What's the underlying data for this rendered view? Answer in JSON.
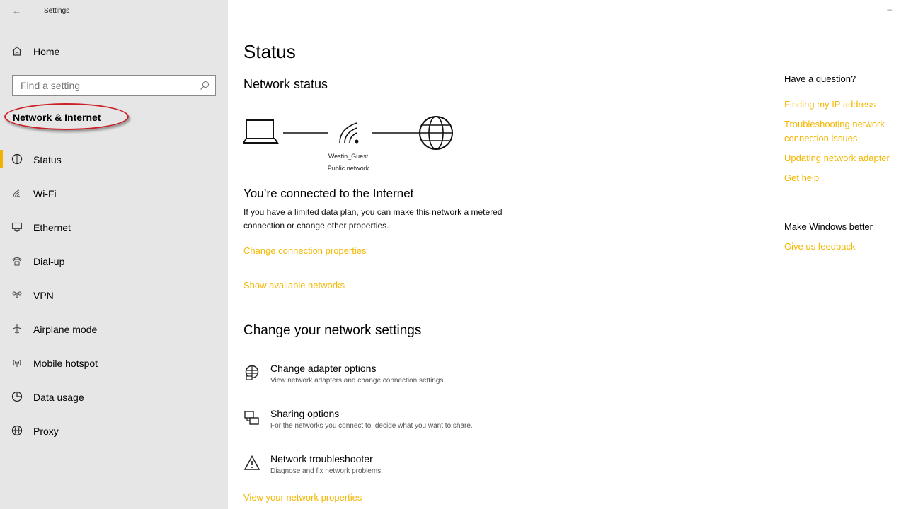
{
  "window": {
    "title": "Settings",
    "back_icon": "back-arrow-icon",
    "minimize_glyph": "–"
  },
  "sidebar": {
    "home_label": "Home",
    "search_placeholder": "Find a setting",
    "section_title": "Network & Internet",
    "highlight_color": "#cc1f27",
    "accent_color": "#f0b400",
    "items": [
      {
        "label": "Status",
        "icon": "status-globe-icon",
        "active": true
      },
      {
        "label": "Wi-Fi",
        "icon": "wifi-icon"
      },
      {
        "label": "Ethernet",
        "icon": "ethernet-icon"
      },
      {
        "label": "Dial-up",
        "icon": "dialup-icon"
      },
      {
        "label": "VPN",
        "icon": "vpn-icon"
      },
      {
        "label": "Airplane mode",
        "icon": "airplane-icon"
      },
      {
        "label": "Mobile hotspot",
        "icon": "hotspot-icon"
      },
      {
        "label": "Data usage",
        "icon": "data-usage-icon"
      },
      {
        "label": "Proxy",
        "icon": "proxy-globe-icon"
      }
    ]
  },
  "main": {
    "title": "Status",
    "network_status_heading": "Network status",
    "diagram": {
      "network_name": "Westin_Guest",
      "network_type": "Public network"
    },
    "connected_heading": "You’re connected to the Internet",
    "description": "If you have a limited data plan, you can make this network a metered connection or change other properties.",
    "link_change_properties": "Change connection properties",
    "link_show_networks": "Show available networks",
    "change_settings_heading": "Change your network settings",
    "options": [
      {
        "title": "Change adapter options",
        "desc": "View network adapters and change connection settings.",
        "icon": "adapter-icon"
      },
      {
        "title": "Sharing options",
        "desc": "For the networks you connect to, decide what you want to share.",
        "icon": "sharing-icon"
      },
      {
        "title": "Network troubleshooter",
        "desc": "Diagnose and fix network problems.",
        "icon": "warning-icon"
      }
    ],
    "link_view_properties": "View your network properties",
    "link_color": "#f5b700"
  },
  "right": {
    "question_heading": "Have a question?",
    "links": [
      "Finding my IP address",
      "Troubleshooting network connection issues",
      "Updating network adapter",
      "Get help"
    ],
    "better_heading": "Make Windows better",
    "feedback_link": "Give us feedback"
  }
}
